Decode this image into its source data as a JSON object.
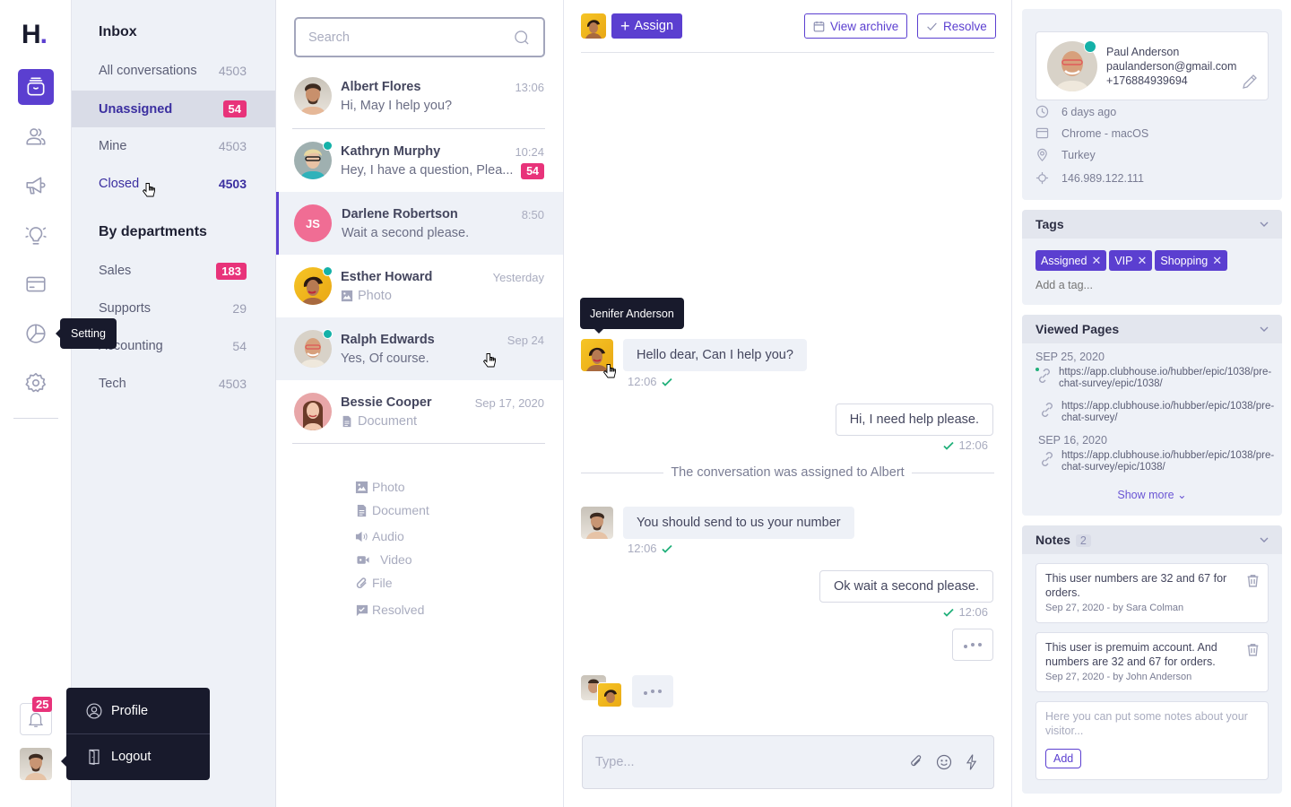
{
  "app": {
    "logo": "H",
    "logo_dot": "."
  },
  "rail": {
    "items": [
      {
        "name": "inbox",
        "icon": "inbox-icon",
        "active": true
      },
      {
        "name": "contacts",
        "icon": "users-icon"
      },
      {
        "name": "campaigns",
        "icon": "megaphone-icon"
      },
      {
        "name": "ideas",
        "icon": "lightbulb-icon"
      },
      {
        "name": "billing",
        "icon": "credit-card-icon"
      },
      {
        "name": "reports",
        "icon": "pie-chart-icon"
      },
      {
        "name": "settings",
        "icon": "gear-icon"
      }
    ],
    "tooltip": "Setting",
    "notifications_count": "25",
    "user_menu": {
      "profile": "Profile",
      "logout": "Logout"
    }
  },
  "inbox": {
    "title": "Inbox",
    "items": [
      {
        "label": "All conversations",
        "count": "4503"
      },
      {
        "label": "Unassigned",
        "count": "54",
        "selected": true
      },
      {
        "label": "Mine",
        "count": "4503"
      },
      {
        "label": "Closed",
        "count": "4503"
      }
    ],
    "departments_title": "By departments",
    "departments": [
      {
        "label": "Sales",
        "count": "183"
      },
      {
        "label": "Supports",
        "count": "29"
      },
      {
        "label": "Accounting",
        "count": "54"
      },
      {
        "label": "Tech",
        "count": "4503"
      }
    ]
  },
  "conversations": {
    "search_placeholder": "Search",
    "items": [
      {
        "name": "Albert Flores",
        "preview": "Hi, May I help you?",
        "time": "13:06",
        "online": false
      },
      {
        "name": "Kathryn Murphy",
        "preview": "Hey, I have a question, Plea...",
        "time": "10:24",
        "online": true,
        "unread": "54"
      },
      {
        "name": "Darlene Robertson",
        "initials": "JS",
        "preview": "Wait a second please.",
        "time": "8:50",
        "selected": true
      },
      {
        "name": "Esther Howard",
        "preview": "Photo",
        "preview_icon": "photo-icon",
        "time": "Yesterday",
        "online": true
      },
      {
        "name": "Ralph Edwards",
        "preview": "Yes, Of course.",
        "time": "Sep 24",
        "online": true
      },
      {
        "name": "Bessie Cooper",
        "preview": "Document",
        "preview_icon": "document-icon",
        "time": "Sep 17, 2020"
      }
    ],
    "legend": [
      {
        "icon": "photo-icon",
        "label": "Photo"
      },
      {
        "icon": "document-icon",
        "label": "Document"
      },
      {
        "icon": "audio-icon",
        "label": "Audio"
      },
      {
        "icon": "video-icon",
        "label": "Video"
      },
      {
        "icon": "paperclip-icon",
        "label": "File"
      },
      {
        "icon": "resolved-icon",
        "label": "Resolved"
      }
    ]
  },
  "chat": {
    "assign_label": "Assign",
    "view_archive_label": "View archive",
    "resolve_label": "Resolve",
    "agent_tooltip": "Jenifer Anderson",
    "messages": [
      {
        "dir": "in",
        "text": "Hello dear, Can I help you?",
        "time": "12:06"
      },
      {
        "dir": "out",
        "text": "Hi, I need help please.",
        "time": "12:06"
      },
      {
        "dir": "system",
        "text": "The conversation was assigned to Albert"
      },
      {
        "dir": "in",
        "text": "You should send to us your number",
        "time": "12:06"
      },
      {
        "dir": "out",
        "text": "Ok wait a second please.",
        "time": "12:06"
      }
    ],
    "composer_placeholder": "Type..."
  },
  "visitor": {
    "name": "Paul Anderson",
    "email": "paulanderson@gmail.com",
    "phone": "+176884939694",
    "last_seen": "6 days ago",
    "browser": "Chrome - macOS",
    "location": "Turkey",
    "ip": "146.989.122.111"
  },
  "tags": {
    "title": "Tags",
    "items": [
      "Assigned",
      "VIP",
      "Shopping"
    ],
    "add_placeholder": "Add a tag..."
  },
  "viewed_pages": {
    "title": "Viewed Pages",
    "groups": [
      {
        "date": "SEP 25, 2020",
        "links": [
          "https://app.clubhouse.io/hubber/epic/1038/pre-chat-survey/epic/1038/",
          "https://app.clubhouse.io/hubber/epic/1038/pre-chat-survey/"
        ]
      },
      {
        "date": "SEP 16, 2020",
        "links": [
          "https://app.clubhouse.io/hubber/epic/1038/pre-chat-survey/epic/1038/"
        ]
      }
    ],
    "show_more": "Show more"
  },
  "notes": {
    "title": "Notes",
    "count": "2",
    "items": [
      {
        "text": "This user numbers are 32 and 67 for orders.",
        "meta": "Sep 27, 2020 - by Sara Colman"
      },
      {
        "text": "This user is premuim account. And numbers are 32 and 67 for orders.",
        "meta": "Sep 27, 2020 - by John Anderson"
      }
    ],
    "new_placeholder": "Here you can put some notes about your visitor...",
    "add_label": "Add"
  },
  "colors": {
    "accent": "#5b3fd0",
    "badge": "#e8337a",
    "online": "#14b1a8",
    "read_check": "#21b07a",
    "dark": "#181a2c"
  }
}
